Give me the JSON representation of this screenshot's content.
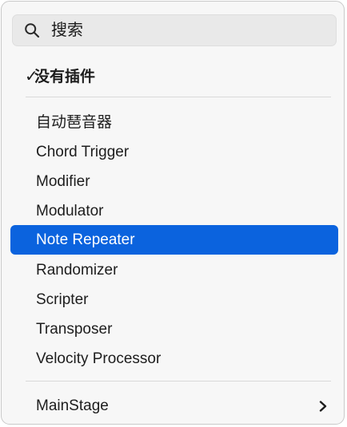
{
  "search": {
    "placeholder": "搜索"
  },
  "menu": {
    "checked_item": {
      "check_mark": "✓",
      "label": "没有插件"
    },
    "plugins": [
      {
        "label": "自动琶音器"
      },
      {
        "label": "Chord Trigger"
      },
      {
        "label": "Modifier"
      },
      {
        "label": "Modulator"
      },
      {
        "label": "Note Repeater",
        "highlighted": true
      },
      {
        "label": "Randomizer"
      },
      {
        "label": "Scripter"
      },
      {
        "label": "Transposer"
      },
      {
        "label": "Velocity Processor"
      }
    ],
    "submenu": {
      "label": "MainStage"
    }
  },
  "colors": {
    "highlight": "#0b63de",
    "menu_background": "#f7f7f7",
    "text": "#1d1d1d"
  },
  "icons": {
    "search": "search-icon",
    "submenu_arrow": "chevron-right-icon"
  }
}
